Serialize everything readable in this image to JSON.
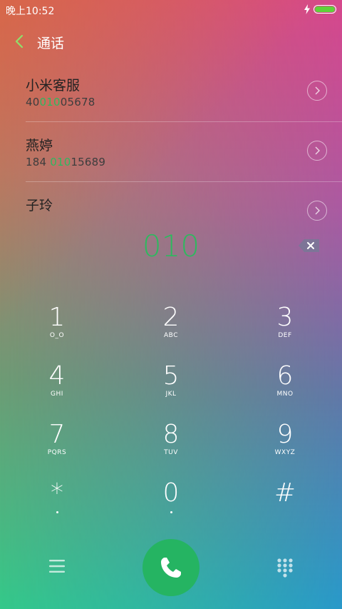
{
  "status_bar": {
    "time": "晚上10:52",
    "battery_color": "#5fd13a"
  },
  "header": {
    "title": "通话"
  },
  "contacts": [
    {
      "name": "小米客服",
      "number_pre": "40",
      "number_match": "010",
      "number_post": "05678"
    },
    {
      "name": "燕婷",
      "number_pre": "184 ",
      "number_match": "010",
      "number_post": "15689"
    },
    {
      "name": "子玲",
      "number_pre": "",
      "number_match": "",
      "number_post": ""
    }
  ],
  "dial_input": {
    "value": "010",
    "color": "#2fb85f"
  },
  "keypad": [
    {
      "digit": "1",
      "letters": "O_O"
    },
    {
      "digit": "2",
      "letters": "ABC"
    },
    {
      "digit": "3",
      "letters": "DEF"
    },
    {
      "digit": "4",
      "letters": "GHI"
    },
    {
      "digit": "5",
      "letters": "JKL"
    },
    {
      "digit": "6",
      "letters": "MNO"
    },
    {
      "digit": "7",
      "letters": "PQRS"
    },
    {
      "digit": "8",
      "letters": "TUV"
    },
    {
      "digit": "9",
      "letters": "WXYZ"
    },
    {
      "digit": "*",
      "letters": ""
    },
    {
      "digit": "0",
      "letters": ""
    },
    {
      "digit": "#",
      "letters": ""
    }
  ],
  "bottom_bar": {
    "menu_icon": "menu-icon",
    "call_icon": "phone-icon",
    "keypad_icon": "dialpad-icon",
    "call_color": "#25b462"
  }
}
